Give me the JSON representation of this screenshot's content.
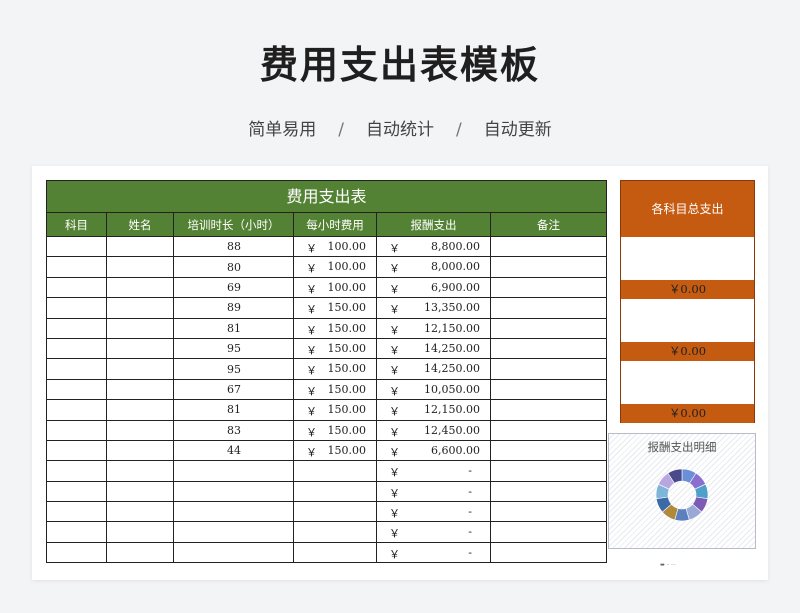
{
  "header": {
    "title": "费用支出表模板",
    "subtitle_items": [
      "简单易用",
      "自动统计",
      "自动更新"
    ],
    "separator": "/"
  },
  "sheet": {
    "title": "费用支出表",
    "columns": [
      "科目",
      "姓名",
      "培训时长（小时）",
      "每小时费用",
      "报酬支出",
      "备注"
    ],
    "currency": "￥",
    "rows": [
      {
        "hours": "88",
        "rate": "100.00",
        "pay": "8,800.00"
      },
      {
        "hours": "80",
        "rate": "100.00",
        "pay": "8,000.00"
      },
      {
        "hours": "69",
        "rate": "100.00",
        "pay": "6,900.00"
      },
      {
        "hours": "89",
        "rate": "150.00",
        "pay": "13,350.00"
      },
      {
        "hours": "81",
        "rate": "150.00",
        "pay": "12,150.00"
      },
      {
        "hours": "95",
        "rate": "150.00",
        "pay": "14,250.00"
      },
      {
        "hours": "95",
        "rate": "150.00",
        "pay": "14,250.00"
      },
      {
        "hours": "67",
        "rate": "150.00",
        "pay": "10,050.00"
      },
      {
        "hours": "81",
        "rate": "150.00",
        "pay": "12,150.00"
      },
      {
        "hours": "83",
        "rate": "150.00",
        "pay": "12,450.00"
      },
      {
        "hours": "44",
        "rate": "150.00",
        "pay": "6,600.00"
      }
    ],
    "empty_pay_text": "-",
    "empty_row_count": 5
  },
  "summary": {
    "title": "各科目总支出",
    "values": [
      "￥0.00",
      "￥0.00",
      "￥0.00"
    ]
  },
  "chart": {
    "title": "报酬支出明细",
    "colors": {
      "accent_green": "#548235",
      "accent_orange": "#c55a11",
      "donut": [
        "#6a8fd8",
        "#8a6fd0",
        "#4ea0c8",
        "#7b5bb5",
        "#9aa8d8",
        "#5c7fc0",
        "#b08a3a",
        "#3c6aa8",
        "#7fb5d8",
        "#b7a6e0",
        "#4a4a8a"
      ]
    }
  }
}
